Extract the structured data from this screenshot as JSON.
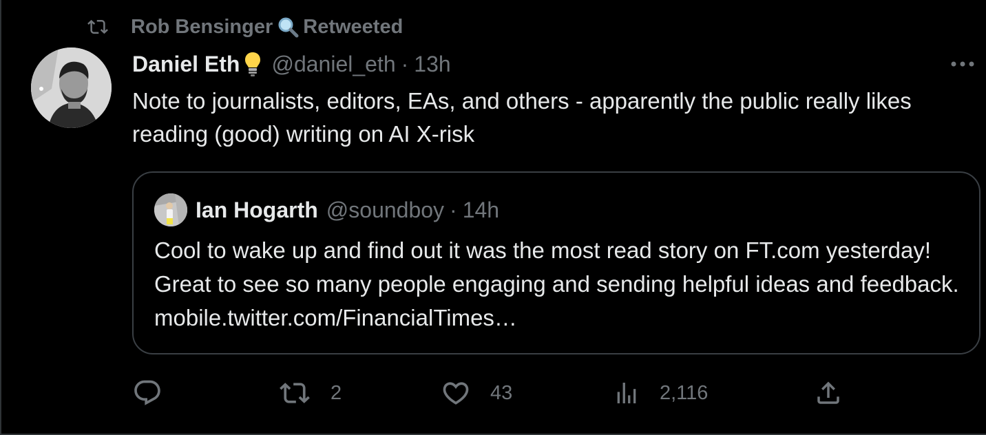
{
  "social_context": {
    "retweeter_name": "Rob Bensinger",
    "retweeted_label": "Retweeted",
    "retweeter_emoji": "search-icon"
  },
  "tweet": {
    "author_name": "Daniel Eth",
    "author_emoji": "lightbulb-icon",
    "handle": "@daniel_eth",
    "separator": "·",
    "time": "13h",
    "text": "Note to journalists, editors, EAs, and others - apparently the public really likes reading (good) writing on AI X-risk"
  },
  "quoted_tweet": {
    "author_name": "Ian Hogarth",
    "handle": "@soundboy",
    "separator": "·",
    "time": "14h",
    "text": "Cool to wake up and find out it was the most read story on FT.com yesterday! Great to see so many people engaging and sending helpful ideas and feedback. mobile.twitter.com/FinancialTimes…"
  },
  "actions": {
    "reply_count": "",
    "retweet_count": "2",
    "like_count": "43",
    "views_count": "2,116"
  },
  "colors": {
    "background": "#000000",
    "text_primary": "#e7e9ea",
    "text_secondary": "#71767b",
    "border": "#2f3336"
  }
}
